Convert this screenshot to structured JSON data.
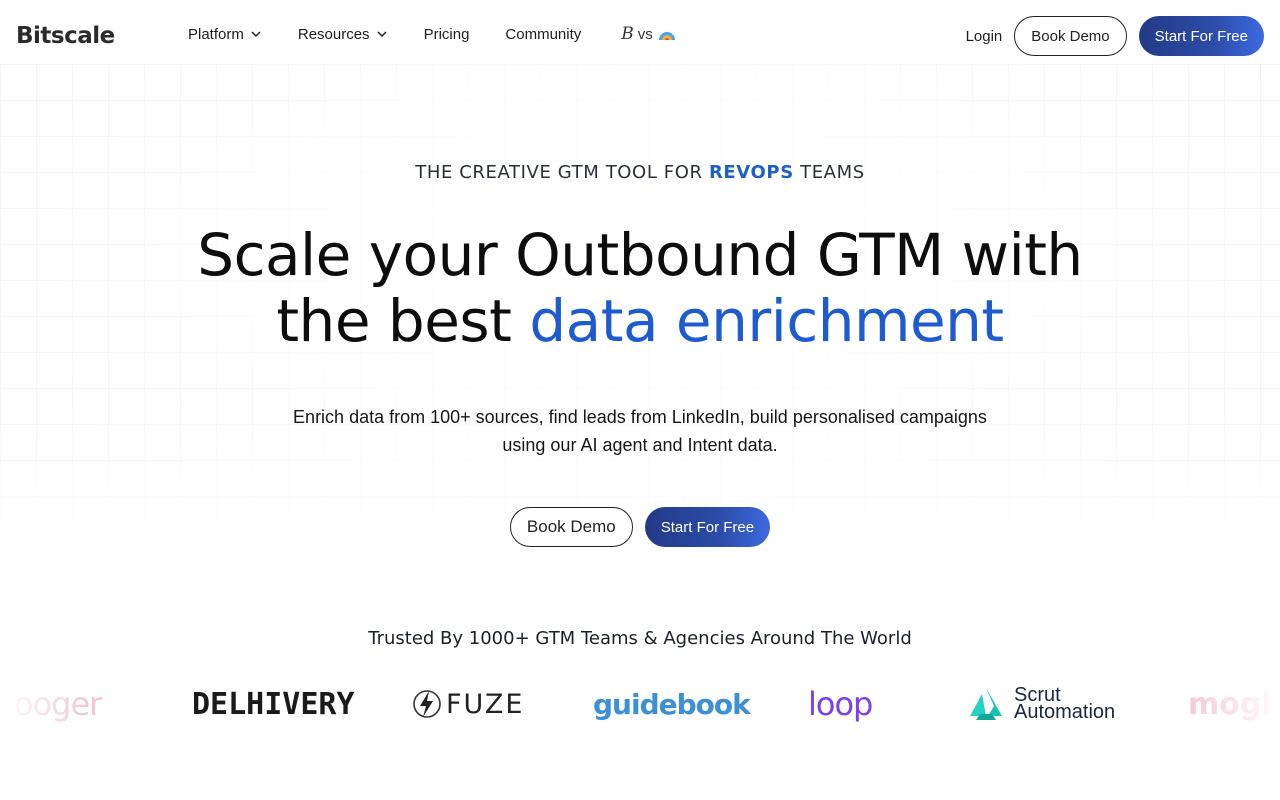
{
  "nav": {
    "logo_text": "Bitscale",
    "items": [
      {
        "label": "Platform",
        "has_dropdown": true
      },
      {
        "label": "Resources",
        "has_dropdown": true
      },
      {
        "label": "Pricing",
        "has_dropdown": false
      },
      {
        "label": "Community",
        "has_dropdown": false
      }
    ],
    "vs_text": "vs",
    "vs_logo_letter": "B",
    "login_label": "Login",
    "book_demo_label": "Book Demo",
    "start_free_label": "Start For Free"
  },
  "hero": {
    "eyebrow_prefix": "THE CREATIVE GTM TOOL FOR",
    "eyebrow_accent": "REVOPS",
    "eyebrow_suffix": "TEAMS",
    "headline_line1": "Scale your Outbound GTM with",
    "headline_line2_prefix": "the best",
    "headline_highlight": "data enrichment",
    "subtext": "Enrich data from 100+ sources, find leads from LinkedIn, build personalised campaigns using our AI agent and Intent data.",
    "book_demo_label": "Book Demo",
    "start_free_label": "Start For Free"
  },
  "trusted": {
    "heading": "Trusted By 1000+ GTM Teams & Agencies Around The World",
    "logos": [
      {
        "name": "ooger",
        "icon": "booger-logo"
      },
      {
        "name": "DELHIVERY",
        "icon": "delhivery-logo"
      },
      {
        "name": "FUZE",
        "icon": "fuze-logo"
      },
      {
        "name": "guidebook",
        "icon": "guidebook-logo"
      },
      {
        "name": "loop",
        "icon": "loop-logo"
      },
      {
        "name": "Scrut",
        "line2": "Automation",
        "icon": "scrut-logo"
      },
      {
        "name": "mogl",
        "icon": "mogli-logo"
      }
    ]
  },
  "colors": {
    "accent_blue": "#1d5bd1",
    "button_gradient_start": "#233a86",
    "button_gradient_end": "#3d6ae0",
    "text_dark": "#0d0d0d"
  }
}
